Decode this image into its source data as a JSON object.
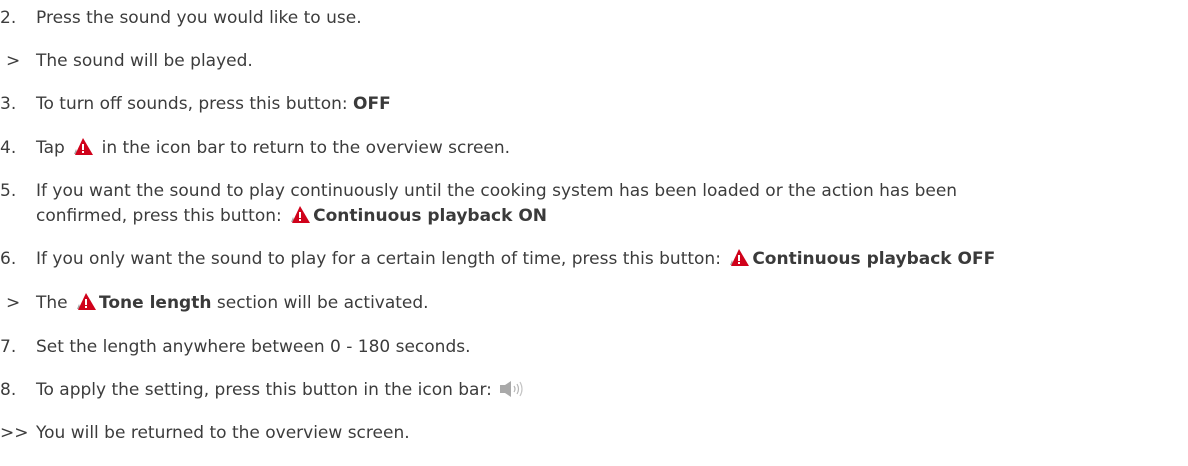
{
  "steps": [
    {
      "marker": "2.",
      "text": "Press the sound you would like to use."
    },
    {
      "marker": ">",
      "text": "The sound will be played."
    },
    {
      "marker": "3.",
      "text_before": "To turn off sounds, press this button: ",
      "bold": "OFF"
    },
    {
      "marker": "4.",
      "text_before": "Tap ",
      "icon": "warning-icon",
      "text_after": " in the icon bar to return to the overview screen."
    },
    {
      "marker": "5.",
      "line1": "If you want the sound to play continuously until the cooking system has been loaded or the action has been",
      "line2_before": "confirmed, press this button: ",
      "icon": "warning-icon",
      "bold": "Continuous playback ON"
    },
    {
      "marker": "6.",
      "text_before": "If you only want the sound to play for a certain length of time, press this button: ",
      "icon": "warning-icon",
      "bold": "Continuous playback OFF"
    },
    {
      "marker": ">",
      "text_before": "The ",
      "icon": "warning-icon",
      "bold": "Tone length",
      "text_after": " section will be activated."
    },
    {
      "marker": "7.",
      "text": "Set the length anywhere between 0 - 180 seconds."
    },
    {
      "marker": "8.",
      "text_before": "To apply the setting, press this button in the icon bar: ",
      "icon": "speaker-icon"
    },
    {
      "marker": ">>",
      "text": "You will be returned to the overview screen."
    }
  ],
  "colors": {
    "text": "#3c3c3c",
    "warning_red": "#d0021b",
    "speaker_gray": "#a9a9a9"
  }
}
